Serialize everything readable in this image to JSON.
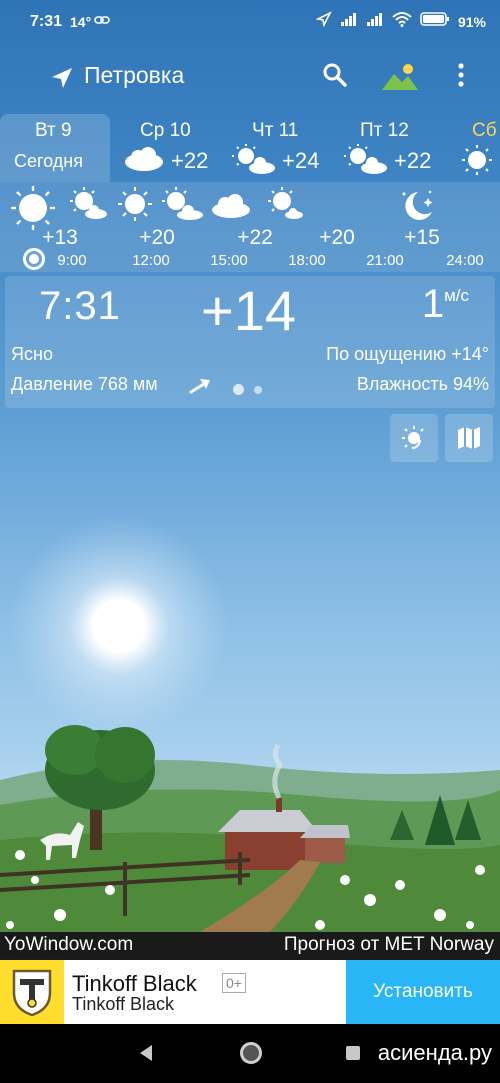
{
  "status": {
    "time": "7:31",
    "temp": "14°",
    "battery": "91%"
  },
  "top_bar": {
    "location": "Петровка",
    "icons": [
      "location-arrow-icon",
      "search-icon",
      "landscape-icon",
      "more-vert-icon"
    ]
  },
  "days": [
    {
      "name": "Вт 9",
      "sub": "Сегодня",
      "temp": "",
      "icon": "",
      "selected": true
    },
    {
      "name": "Ср 10",
      "sub": "",
      "temp": "+22",
      "icon": "cloud",
      "selected": false
    },
    {
      "name": "Чт 11",
      "sub": "",
      "temp": "+24",
      "icon": "sun-cloud",
      "selected": false
    },
    {
      "name": "Пт 12",
      "sub": "",
      "temp": "+22",
      "icon": "sun-cloud",
      "selected": false
    },
    {
      "name": "Сб",
      "sub": "",
      "temp": "",
      "icon": "sun",
      "selected": false
    }
  ],
  "hourly": [
    {
      "temp": "+13",
      "time": "9:00"
    },
    {
      "temp": "+20",
      "time": "12:00"
    },
    {
      "temp": "+22",
      "time": "15:00"
    },
    {
      "temp": "+20",
      "time": "18:00"
    },
    {
      "temp": "+15",
      "time": "21:00"
    },
    {
      "temp": "",
      "time": "24:00"
    }
  ],
  "hourly_icons": [
    "sun",
    "sun-cloud",
    "sun",
    "sun-cloud",
    "cloud",
    "sun-cloud",
    "moon"
  ],
  "current": {
    "time": "7:31",
    "temp": "+14",
    "wind_value": "1",
    "wind_unit": "м/с",
    "condition": "Ясно",
    "feels": "По ощущению +14°",
    "pressure": "Давление 768 мм",
    "humidity": "Влажность 94%"
  },
  "credit": {
    "left": "YoWindow.com",
    "right": "Прогноз от MET Norway"
  },
  "ad": {
    "title": "Tinkoff Black",
    "badge": "0+",
    "subtitle": "Tinkoff Black",
    "button": "Установить"
  },
  "watermark": "асиенда.ру",
  "colors": {
    "sky_top": "#2f74b6",
    "ad_button": "#29b6f6",
    "ad_logo": "#ffdd2d"
  }
}
